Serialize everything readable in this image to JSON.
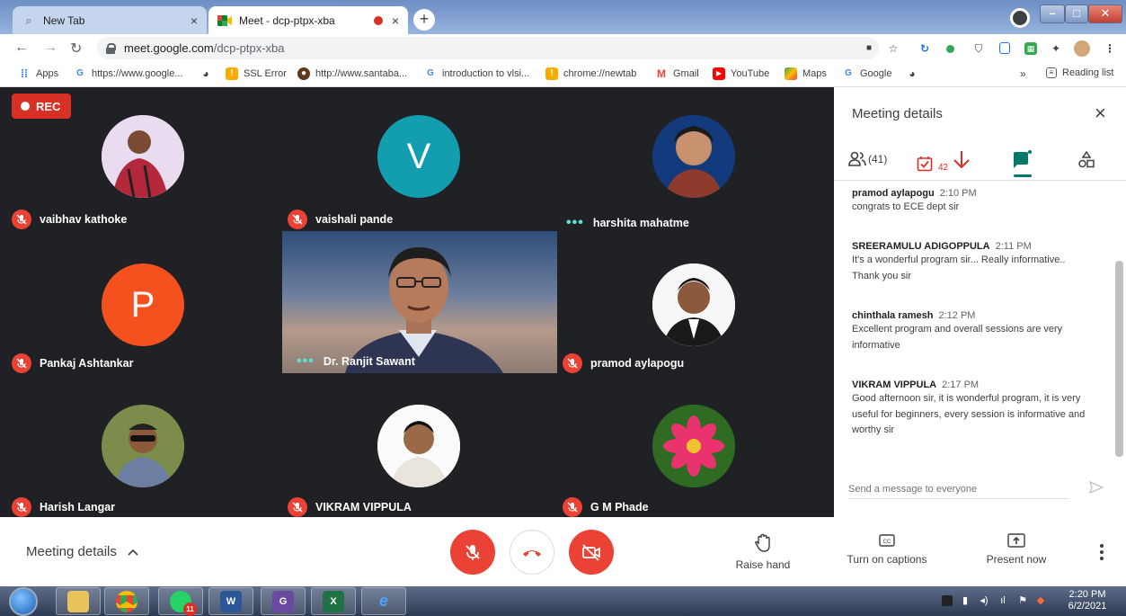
{
  "browser": {
    "tabs": [
      {
        "title": "New Tab",
        "close": "×"
      },
      {
        "title": "Meet - dcp-ptpx-xba",
        "close": "×"
      }
    ],
    "new_tab": "+",
    "url_host": "meet.google.com",
    "url_path": "/dcp-ptpx-xba",
    "bookmarks": [
      {
        "label": "Apps",
        "icon": "apps-grid-icon"
      },
      {
        "label": "https://www.google...",
        "icon": "google-icon"
      },
      {
        "label": "",
        "icon": "globe-icon"
      },
      {
        "label": "SSL Error",
        "icon": "warning-icon"
      },
      {
        "label": "http://www.santaba...",
        "icon": "person-icon"
      },
      {
        "label": "introduction to vlsi...",
        "icon": "google-icon"
      },
      {
        "label": "chrome://newtab",
        "icon": "warning-icon"
      },
      {
        "label": "Gmail",
        "icon": "gmail-icon"
      },
      {
        "label": "YouTube",
        "icon": "youtube-icon"
      },
      {
        "label": "Maps",
        "icon": "maps-icon"
      },
      {
        "label": "Google",
        "icon": "google-icon"
      },
      {
        "label": "",
        "icon": "globe-icon"
      }
    ],
    "bookmarks_more": "»",
    "reading_list": "Reading list"
  },
  "meet": {
    "rec_label": "REC",
    "participants": [
      {
        "name": "vaibhav kathoke",
        "muted": true,
        "avatar": "photo"
      },
      {
        "name": "vaishali pande",
        "muted": true,
        "avatar": "V",
        "avatar_color": "#129eaf"
      },
      {
        "name": "harshita mahatme",
        "muted": false,
        "avatar": "photo"
      },
      {
        "name": "Pankaj Ashtankar",
        "muted": true,
        "avatar": "P",
        "avatar_color": "#f4511e"
      },
      {
        "name": "Dr. Ranjit Sawant",
        "muted": false,
        "avatar": "video"
      },
      {
        "name": "pramod aylapogu",
        "muted": true,
        "avatar": "photo"
      },
      {
        "name": "Harish Langar",
        "muted": true,
        "avatar": "photo"
      },
      {
        "name": "VIKRAM VIPPULA",
        "muted": true,
        "avatar": "photo"
      },
      {
        "name": "G M Phade",
        "muted": true,
        "avatar": "photo"
      }
    ]
  },
  "panel": {
    "title": "Meeting details",
    "close": "×",
    "people_count": "(41)",
    "task_count": "42",
    "compose_placeholder": "Send a message to everyone",
    "messages": [
      {
        "sender": "pramod aylapogu",
        "time": "2:10 PM",
        "text": "congrats to ECE dept sir"
      },
      {
        "sender": "SREERAMULU ADIGOPPULA",
        "time": "2:11 PM",
        "text": "It's a wonderful program  sir... Really  informative.. Thank you sir"
      },
      {
        "sender": "chinthala ramesh",
        "time": "2:12 PM",
        "text": "Excellent program and overall sessions are very informative"
      },
      {
        "sender": "VIKRAM VIPPULA",
        "time": "2:17 PM",
        "text": "Good afternoon sir, it is wonderful program, it is very useful for beginners, every session is informative and worthy sir"
      }
    ]
  },
  "bottom": {
    "meeting_details": "Meeting details",
    "raise_hand": "Raise hand",
    "captions": "Turn on captions",
    "present": "Present now"
  },
  "taskbar": {
    "time": "2:20 PM",
    "date": "6/2/2021",
    "whatsapp_badge": "11"
  },
  "colors": {
    "accent": "#00796b",
    "danger": "#ea4335",
    "rec": "#d93025"
  }
}
